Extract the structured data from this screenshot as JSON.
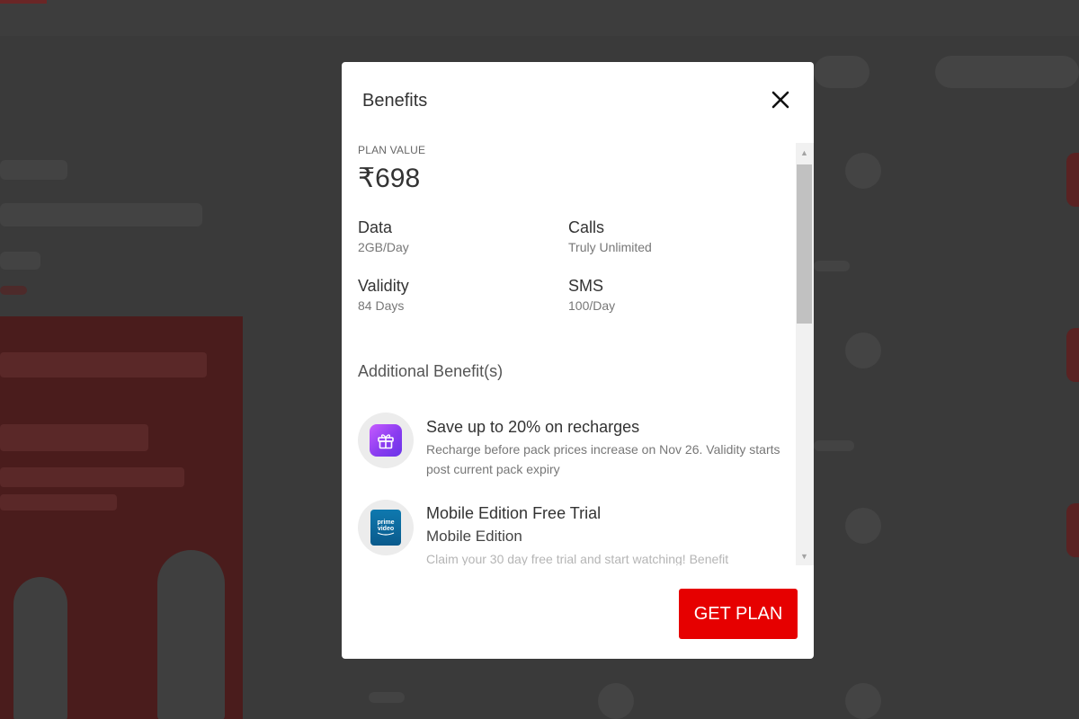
{
  "modal": {
    "title": "Benefits",
    "plan_value_label": "PLAN VALUE",
    "plan_price": "₹698",
    "specs": [
      {
        "key": "Data",
        "value": "2GB/Day"
      },
      {
        "key": "Calls",
        "value": "Truly Unlimited"
      },
      {
        "key": "Validity",
        "value": "84 Days"
      },
      {
        "key": "SMS",
        "value": "100/Day"
      }
    ],
    "additional_title": "Additional Benefit(s)",
    "benefits": [
      {
        "icon": "gift-icon",
        "title": "Save up to 20% on recharges",
        "description": "Recharge before pack prices increase on Nov 26. Validity starts post current pack expiry"
      },
      {
        "icon": "prime-video-icon",
        "icon_text": [
          "prime",
          "video"
        ],
        "title": "Mobile Edition Free Trial",
        "subtitle": "Mobile Edition",
        "description": "Claim your 30 day free trial and start watching! Benefit"
      }
    ],
    "get_plan_label": "GET PLAN"
  },
  "colors": {
    "accent": "#e60000",
    "overlay_bg": "#3a3a3a",
    "gift_gradient_start": "#c65cff",
    "gift_gradient_end": "#6a35e8",
    "prime_blue": "#0f79af"
  }
}
